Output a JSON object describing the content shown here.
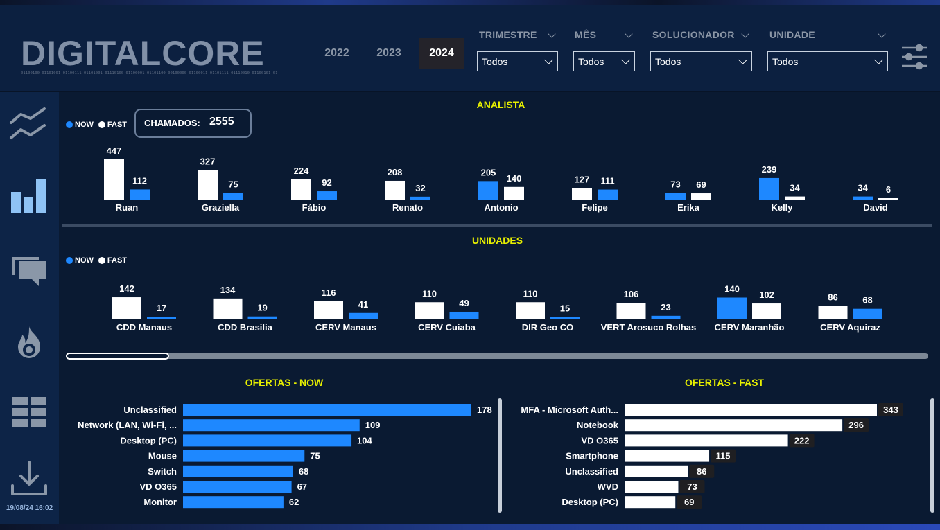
{
  "header": {
    "logo_text": "DIGITALCORE",
    "logo_binary": "01100100 01101001 01100111 01101001 01110100 01100001 01101100 00100000 01100011 01101111 01110010 01100101 01100100 01101001",
    "years": [
      "2022",
      "2023",
      "2024"
    ],
    "selected_year": "2024",
    "filters": [
      {
        "label": "TRIMESTRE",
        "value": "Todos"
      },
      {
        "label": "MÊS",
        "value": "Todos"
      },
      {
        "label": "SOLUCIONADOR",
        "value": "Todos"
      },
      {
        "label": "UNIDADE",
        "value": "Todos"
      }
    ]
  },
  "sidebar": {
    "icons": [
      "line-chart-icon",
      "bar-chart-icon",
      "chat-icon",
      "fire-icon",
      "grid-icon",
      "download-icon",
      "filter-sliders-icon"
    ],
    "timestamp": "19/08/24 16:02"
  },
  "colors": {
    "now": "#1e88ff",
    "fast": "#ffffff",
    "title": "#e8f000",
    "background": "#0a1a32"
  },
  "legend": {
    "now": "NOW",
    "fast": "FAST"
  },
  "kpi": {
    "label": "CHAMADOS:",
    "value": "2555"
  },
  "chart_data": [
    {
      "type": "bar",
      "title": "ANALISTA",
      "categories": [
        "Ruan",
        "Graziella",
        "Fábio",
        "Renato",
        "Antonio",
        "Felipe",
        "Erika",
        "Kelly",
        "David"
      ],
      "series": [
        {
          "name": "FAST",
          "values": [
            447,
            327,
            224,
            208,
            140,
            111,
            69,
            34,
            6
          ]
        },
        {
          "name": "NOW",
          "values": [
            112,
            75,
            92,
            32,
            205,
            127,
            73,
            239,
            34
          ]
        }
      ],
      "bar_left": [
        "FAST",
        "FAST",
        "FAST",
        "FAST",
        "NOW",
        "FAST",
        "NOW",
        "NOW",
        "NOW"
      ],
      "left_values": [
        447,
        327,
        224,
        208,
        205,
        127,
        73,
        239,
        34
      ],
      "right_values": [
        112,
        75,
        92,
        32,
        140,
        111,
        69,
        34,
        6
      ],
      "left_colors": [
        "#ffffff",
        "#ffffff",
        "#ffffff",
        "#ffffff",
        "#1e88ff",
        "#ffffff",
        "#1e88ff",
        "#1e88ff",
        "#1e88ff"
      ],
      "right_colors": [
        "#1e88ff",
        "#1e88ff",
        "#1e88ff",
        "#1e88ff",
        "#ffffff",
        "#1e88ff",
        "#ffffff",
        "#ffffff",
        "#ffffff"
      ]
    },
    {
      "type": "bar",
      "title": "UNIDADES",
      "categories": [
        "CDD Manaus",
        "CDD Brasilia",
        "CERV Manaus",
        "CERV Cuiaba",
        "DIR Geo CO",
        "VERT Arosuco Rolhas",
        "CERV Maranhão",
        "CERV Aquiraz"
      ],
      "left_values": [
        142,
        134,
        116,
        110,
        110,
        106,
        140,
        86
      ],
      "right_values": [
        17,
        19,
        41,
        49,
        15,
        23,
        102,
        68
      ],
      "left_colors": [
        "#ffffff",
        "#ffffff",
        "#ffffff",
        "#ffffff",
        "#ffffff",
        "#ffffff",
        "#1e88ff",
        "#ffffff"
      ],
      "right_colors": [
        "#1e88ff",
        "#1e88ff",
        "#1e88ff",
        "#1e88ff",
        "#1e88ff",
        "#1e88ff",
        "#ffffff",
        "#1e88ff"
      ]
    },
    {
      "type": "bar",
      "orientation": "horizontal",
      "title": "OFERTAS - NOW",
      "categories": [
        "Unclassified",
        "Network (LAN, Wi-Fi, ...",
        "Desktop (PC)",
        "Mouse",
        "Switch",
        "VD O365",
        "Monitor"
      ],
      "values": [
        178,
        109,
        104,
        75,
        68,
        67,
        62
      ],
      "color": "#1e88ff"
    },
    {
      "type": "bar",
      "orientation": "horizontal",
      "title": "OFERTAS - FAST",
      "categories": [
        "MFA - Microsoft Auth...",
        "Notebook",
        "VD O365",
        "Smartphone",
        "Unclassified",
        "WVD",
        "Desktop (PC)"
      ],
      "values": [
        343,
        296,
        222,
        115,
        86,
        73,
        69
      ],
      "color": "#ffffff"
    }
  ]
}
